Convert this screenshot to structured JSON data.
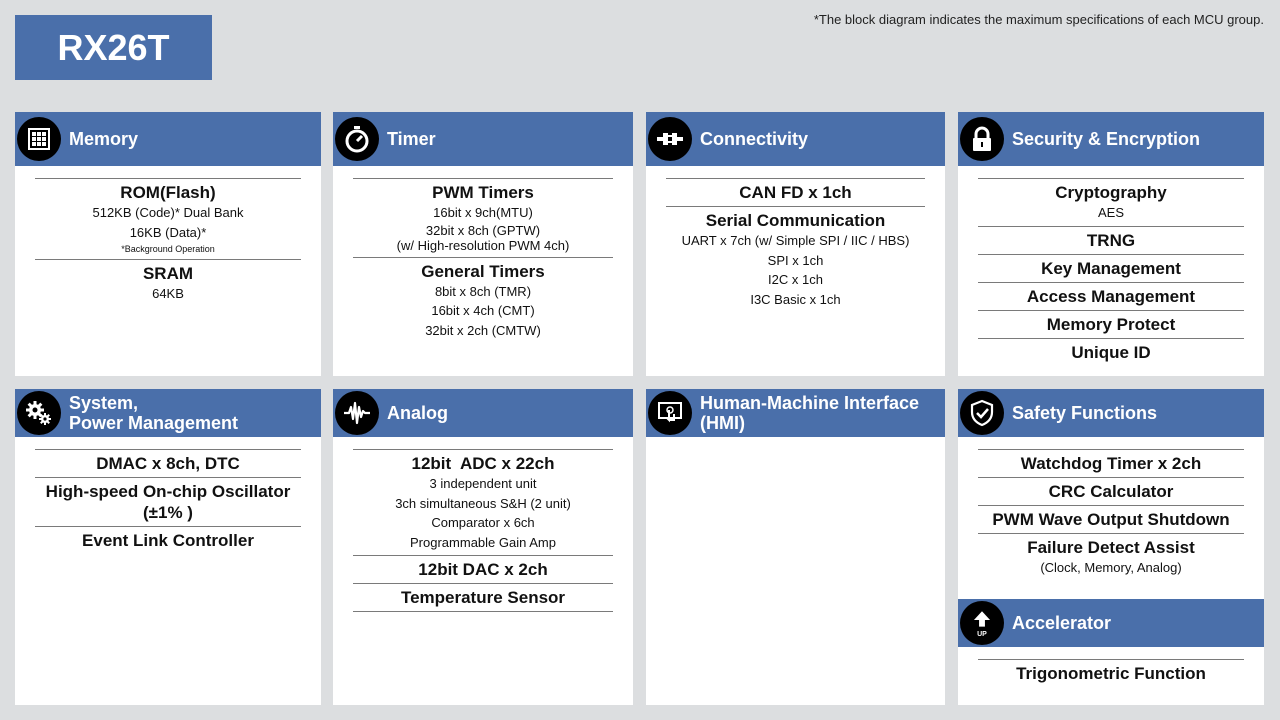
{
  "page_title": "RX26T",
  "note": "*The block diagram indicates the maximum specifications of each MCU group.",
  "colors": {
    "header": "#4a6faa",
    "background": "#dcdee0",
    "card": "#ffffff"
  },
  "cards": {
    "memory": {
      "title": "Memory",
      "icon": "memory-chip-icon",
      "rom_title": "ROM(Flash)",
      "rom_line1": "512KB (Code)* Dual Bank",
      "rom_line2": "16KB (Data)*",
      "rom_note": "*Background Operation",
      "sram_title": "SRAM",
      "sram_line1": "64KB"
    },
    "timer": {
      "title": "Timer",
      "icon": "stopwatch-icon",
      "pwm_title": "PWM Timers",
      "pwm_line1": "16bit x 9ch(MTU)",
      "pwm_line2": "32bit x 8ch (GPTW)",
      "pwm_line3": "(w/ High-resolution PWM 4ch)",
      "gen_title": "General Timers",
      "gen_line1": "8bit x 8ch (TMR)",
      "gen_line2": "16bit x 4ch (CMT)",
      "gen_line3": "32bit x 2ch (CMTW)"
    },
    "connectivity": {
      "title": "Connectivity",
      "icon": "plug-icon",
      "can_title": "CAN FD x 1ch",
      "serial_title": "Serial Communication",
      "serial_line1": "UART x 7ch (w/ Simple SPI / IIC / HBS)",
      "serial_line2": "SPI x 1ch",
      "serial_line3": "I2C x 1ch",
      "serial_line4": "I3C Basic x 1ch"
    },
    "security": {
      "title": "Security & Encryption",
      "icon": "lock-icon",
      "crypto_title": "Cryptography",
      "crypto_line1": "AES",
      "trng": "TRNG",
      "key": "Key Management",
      "access": "Access Management",
      "memprot": "Memory Protect",
      "uid": "Unique ID"
    },
    "system": {
      "title_line1": "System,",
      "title_line2": "Power Management",
      "icon": "gears-icon",
      "dmac": "DMAC x 8ch, DTC",
      "osc_line1": "High-speed On-chip Oscillator",
      "osc_line2": "(±1% )",
      "elc": "Event Link Controller"
    },
    "analog": {
      "title": "Analog",
      "icon": "waveform-icon",
      "adc_title": "12bit  ADC x 22ch",
      "adc_line1": "3 independent unit",
      "adc_line2": "3ch simultaneous S&H (2 unit)",
      "adc_line3": "Comparator x 6ch",
      "adc_line4": "Programmable Gain Amp",
      "dac": "12bit DAC x 2ch",
      "temp": "Temperature Sensor"
    },
    "hmi": {
      "title_line1": "Human-Machine Interface",
      "title_line2": "(HMI)",
      "icon": "touch-screen-icon"
    },
    "safety": {
      "title": "Safety Functions",
      "icon": "shield-check-icon",
      "wdt": "Watchdog Timer x 2ch",
      "crc": "CRC Calculator",
      "pwm_shut": "PWM Wave Output Shutdown",
      "fda_title": "Failure Detect Assist",
      "fda_line1": "(Clock, Memory, Analog)"
    },
    "accelerator": {
      "title": "Accelerator",
      "icon": "up-arrow-icon",
      "icon_label": "UP",
      "trig": "Trigonometric Function"
    }
  }
}
